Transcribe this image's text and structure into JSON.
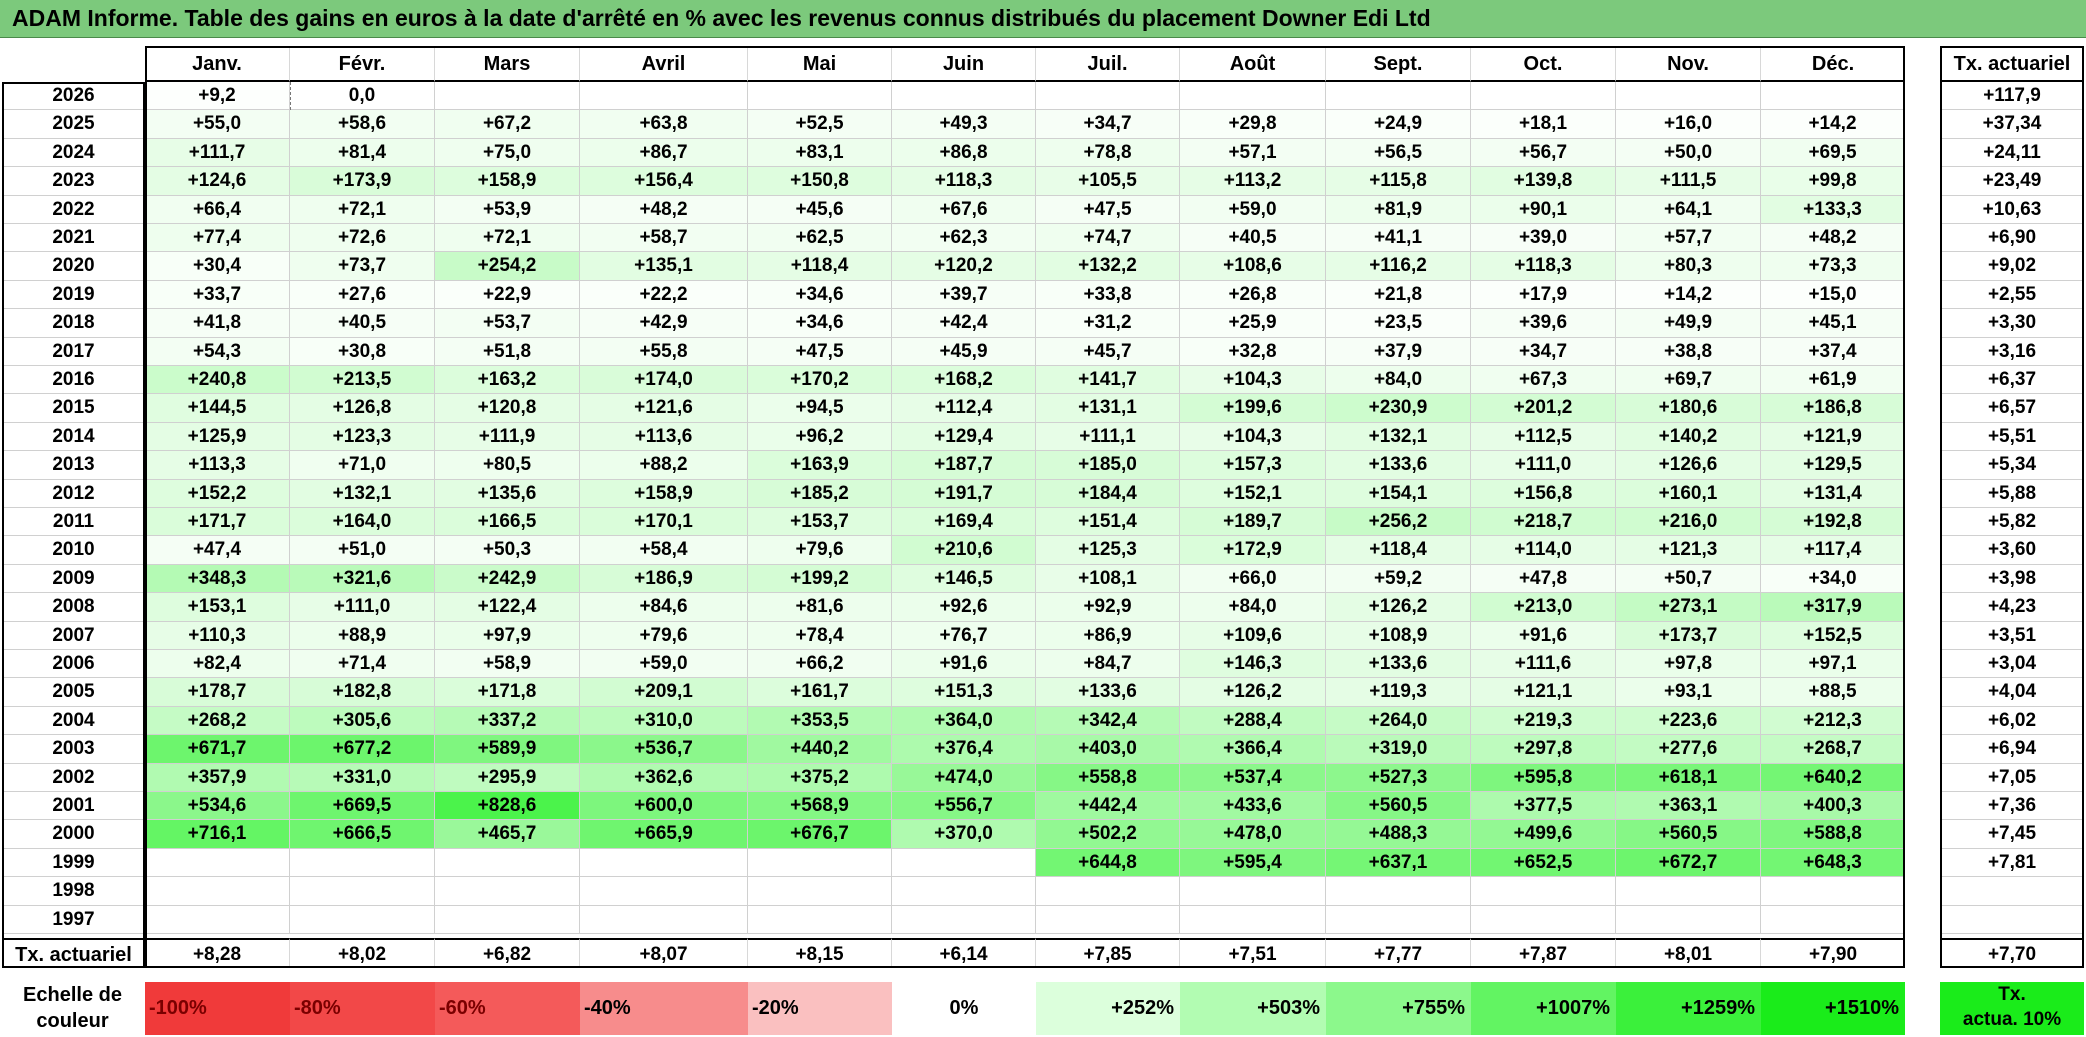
{
  "title": "ADAM Informe. Table des gains en euros à la date d'arrêté en % avec les revenus connus distribués du placement Downer Edi Ltd",
  "months": [
    "Janv.",
    "Févr.",
    "Mars",
    "Avril",
    "Mai",
    "Juin",
    "Juil.",
    "Août",
    "Sept.",
    "Oct.",
    "Nov.",
    "Déc."
  ],
  "annual_header": "Tx. actuariel",
  "rows": [
    {
      "year": "2026",
      "values": [
        "+9,2",
        "0,0",
        "",
        "",
        "",
        "",
        "",
        "",
        "",
        "",
        "",
        ""
      ],
      "annual": "+117,9"
    },
    {
      "year": "2025",
      "values": [
        "+55,0",
        "+58,6",
        "+67,2",
        "+63,8",
        "+52,5",
        "+49,3",
        "+34,7",
        "+29,8",
        "+24,9",
        "+18,1",
        "+16,0",
        "+14,2"
      ],
      "annual": "+37,34"
    },
    {
      "year": "2024",
      "values": [
        "+111,7",
        "+81,4",
        "+75,0",
        "+86,7",
        "+83,1",
        "+86,8",
        "+78,8",
        "+57,1",
        "+56,5",
        "+56,7",
        "+50,0",
        "+69,5"
      ],
      "annual": "+24,11"
    },
    {
      "year": "2023",
      "values": [
        "+124,6",
        "+173,9",
        "+158,9",
        "+156,4",
        "+150,8",
        "+118,3",
        "+105,5",
        "+113,2",
        "+115,8",
        "+139,8",
        "+111,5",
        "+99,8"
      ],
      "annual": "+23,49"
    },
    {
      "year": "2022",
      "values": [
        "+66,4",
        "+72,1",
        "+53,9",
        "+48,2",
        "+45,6",
        "+67,6",
        "+47,5",
        "+59,0",
        "+81,9",
        "+90,1",
        "+64,1",
        "+133,3"
      ],
      "annual": "+10,63"
    },
    {
      "year": "2021",
      "values": [
        "+77,4",
        "+72,6",
        "+72,1",
        "+58,7",
        "+62,5",
        "+62,3",
        "+74,7",
        "+40,5",
        "+41,1",
        "+39,0",
        "+57,7",
        "+48,2"
      ],
      "annual": "+6,90"
    },
    {
      "year": "2020",
      "values": [
        "+30,4",
        "+73,7",
        "+254,2",
        "+135,1",
        "+118,4",
        "+120,2",
        "+132,2",
        "+108,6",
        "+116,2",
        "+118,3",
        "+80,3",
        "+73,3"
      ],
      "annual": "+9,02"
    },
    {
      "year": "2019",
      "values": [
        "+33,7",
        "+27,6",
        "+22,9",
        "+22,2",
        "+34,6",
        "+39,7",
        "+33,8",
        "+26,8",
        "+21,8",
        "+17,9",
        "+14,2",
        "+15,0"
      ],
      "annual": "+2,55"
    },
    {
      "year": "2018",
      "values": [
        "+41,8",
        "+40,5",
        "+53,7",
        "+42,9",
        "+34,6",
        "+42,4",
        "+31,2",
        "+25,9",
        "+23,5",
        "+39,6",
        "+49,9",
        "+45,1"
      ],
      "annual": "+3,30"
    },
    {
      "year": "2017",
      "values": [
        "+54,3",
        "+30,8",
        "+51,8",
        "+55,8",
        "+47,5",
        "+45,9",
        "+45,7",
        "+32,8",
        "+37,9",
        "+34,7",
        "+38,8",
        "+37,4"
      ],
      "annual": "+3,16"
    },
    {
      "year": "2016",
      "values": [
        "+240,8",
        "+213,5",
        "+163,2",
        "+174,0",
        "+170,2",
        "+168,2",
        "+141,7",
        "+104,3",
        "+84,0",
        "+67,3",
        "+69,7",
        "+61,9"
      ],
      "annual": "+6,37"
    },
    {
      "year": "2015",
      "values": [
        "+144,5",
        "+126,8",
        "+120,8",
        "+121,6",
        "+94,5",
        "+112,4",
        "+131,1",
        "+199,6",
        "+230,9",
        "+201,2",
        "+180,6",
        "+186,8"
      ],
      "annual": "+6,57"
    },
    {
      "year": "2014",
      "values": [
        "+125,9",
        "+123,3",
        "+111,9",
        "+113,6",
        "+96,2",
        "+129,4",
        "+111,1",
        "+104,3",
        "+132,1",
        "+112,5",
        "+140,2",
        "+121,9"
      ],
      "annual": "+5,51"
    },
    {
      "year": "2013",
      "values": [
        "+113,3",
        "+71,0",
        "+80,5",
        "+88,2",
        "+163,9",
        "+187,7",
        "+185,0",
        "+157,3",
        "+133,6",
        "+111,0",
        "+126,6",
        "+129,5"
      ],
      "annual": "+5,34"
    },
    {
      "year": "2012",
      "values": [
        "+152,2",
        "+132,1",
        "+135,6",
        "+158,9",
        "+185,2",
        "+191,7",
        "+184,4",
        "+152,1",
        "+154,1",
        "+156,8",
        "+160,1",
        "+131,4"
      ],
      "annual": "+5,88"
    },
    {
      "year": "2011",
      "values": [
        "+171,7",
        "+164,0",
        "+166,5",
        "+170,1",
        "+153,7",
        "+169,4",
        "+151,4",
        "+189,7",
        "+256,2",
        "+218,7",
        "+216,0",
        "+192,8"
      ],
      "annual": "+5,82"
    },
    {
      "year": "2010",
      "values": [
        "+47,4",
        "+51,0",
        "+50,3",
        "+58,4",
        "+79,6",
        "+210,6",
        "+125,3",
        "+172,9",
        "+118,4",
        "+114,0",
        "+121,3",
        "+117,4"
      ],
      "annual": "+3,60"
    },
    {
      "year": "2009",
      "values": [
        "+348,3",
        "+321,6",
        "+242,9",
        "+186,9",
        "+199,2",
        "+146,5",
        "+108,1",
        "+66,0",
        "+59,2",
        "+47,8",
        "+50,7",
        "+34,0"
      ],
      "annual": "+3,98"
    },
    {
      "year": "2008",
      "values": [
        "+153,1",
        "+111,0",
        "+122,4",
        "+84,6",
        "+81,6",
        "+92,6",
        "+92,9",
        "+84,0",
        "+126,2",
        "+213,0",
        "+273,1",
        "+317,9"
      ],
      "annual": "+4,23"
    },
    {
      "year": "2007",
      "values": [
        "+110,3",
        "+88,9",
        "+97,9",
        "+79,6",
        "+78,4",
        "+76,7",
        "+86,9",
        "+109,6",
        "+108,9",
        "+91,6",
        "+173,7",
        "+152,5"
      ],
      "annual": "+3,51"
    },
    {
      "year": "2006",
      "values": [
        "+82,4",
        "+71,4",
        "+58,9",
        "+59,0",
        "+66,2",
        "+91,6",
        "+84,7",
        "+146,3",
        "+133,6",
        "+111,6",
        "+97,8",
        "+97,1"
      ],
      "annual": "+3,04"
    },
    {
      "year": "2005",
      "values": [
        "+178,7",
        "+182,8",
        "+171,8",
        "+209,1",
        "+161,7",
        "+151,3",
        "+133,6",
        "+126,2",
        "+119,3",
        "+121,1",
        "+93,1",
        "+88,5"
      ],
      "annual": "+4,04"
    },
    {
      "year": "2004",
      "values": [
        "+268,2",
        "+305,6",
        "+337,2",
        "+310,0",
        "+353,5",
        "+364,0",
        "+342,4",
        "+288,4",
        "+264,0",
        "+219,3",
        "+223,6",
        "+212,3"
      ],
      "annual": "+6,02"
    },
    {
      "year": "2003",
      "values": [
        "+671,7",
        "+677,2",
        "+589,9",
        "+536,7",
        "+440,2",
        "+376,4",
        "+403,0",
        "+366,4",
        "+319,0",
        "+297,8",
        "+277,6",
        "+268,7"
      ],
      "annual": "+6,94"
    },
    {
      "year": "2002",
      "values": [
        "+357,9",
        "+331,0",
        "+295,9",
        "+362,6",
        "+375,2",
        "+474,0",
        "+558,8",
        "+537,4",
        "+527,3",
        "+595,8",
        "+618,1",
        "+640,2"
      ],
      "annual": "+7,05"
    },
    {
      "year": "2001",
      "values": [
        "+534,6",
        "+669,5",
        "+828,6",
        "+600,0",
        "+568,9",
        "+556,7",
        "+442,4",
        "+433,6",
        "+560,5",
        "+377,5",
        "+363,1",
        "+400,3"
      ],
      "annual": "+7,36"
    },
    {
      "year": "2000",
      "values": [
        "+716,1",
        "+666,5",
        "+465,7",
        "+665,9",
        "+676,7",
        "+370,0",
        "+502,2",
        "+478,0",
        "+488,3",
        "+499,6",
        "+560,5",
        "+588,8"
      ],
      "annual": "+7,45"
    },
    {
      "year": "1999",
      "values": [
        "",
        "",
        "",
        "",
        "",
        "",
        "+644,8",
        "+595,4",
        "+637,1",
        "+652,5",
        "+672,7",
        "+648,3"
      ],
      "annual": "+7,81"
    },
    {
      "year": "1998",
      "values": [
        "",
        "",
        "",
        "",
        "",
        "",
        "",
        "",
        "",
        "",
        "",
        ""
      ],
      "annual": ""
    },
    {
      "year": "1997",
      "values": [
        "",
        "",
        "",
        "",
        "",
        "",
        "",
        "",
        "",
        "",
        "",
        ""
      ],
      "annual": ""
    }
  ],
  "footer": {
    "label": "Tx. actuariel",
    "values": [
      "+8,28",
      "+8,02",
      "+6,82",
      "+8,07",
      "+8,15",
      "+6,14",
      "+7,85",
      "+7,51",
      "+7,77",
      "+7,87",
      "+8,01",
      "+7,90"
    ],
    "annual": "+7,70"
  },
  "scale": {
    "label_line1": "Echelle de",
    "label_line2": "couleur",
    "items": [
      {
        "text": "-100%",
        "color": "#f03a3a"
      },
      {
        "text": "-80%",
        "color": "#f24848"
      },
      {
        "text": "-60%",
        "color": "#f45a5a"
      },
      {
        "text": "-40%",
        "color": "#f78c8c"
      },
      {
        "text": "-20%",
        "color": "#fac0c0"
      },
      {
        "text": "0%",
        "color": "#ffffff"
      },
      {
        "text": "+252%",
        "color": "#dcffdc"
      },
      {
        "text": "+503%",
        "color": "#b2fcb2"
      },
      {
        "text": "+755%",
        "color": "#8cf88c"
      },
      {
        "text": "+1007%",
        "color": "#62f462"
      },
      {
        "text": "+1259%",
        "color": "#3bf03b"
      },
      {
        "text": "+1510%",
        "color": "#1aec1a"
      }
    ],
    "annual_line1": "Tx.",
    "annual_line2": "actua. 10%",
    "annual_color": "#1aec1a"
  }
}
